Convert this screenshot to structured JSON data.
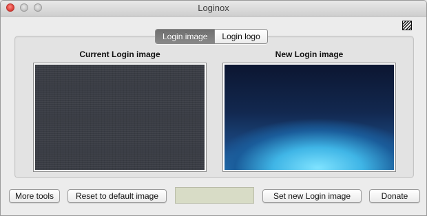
{
  "window": {
    "title": "Loginox"
  },
  "tabs": [
    {
      "label": "Login image",
      "active": true
    },
    {
      "label": "Login logo",
      "active": false
    }
  ],
  "panels": {
    "current_label": "Current Login image",
    "new_label": "New Login image"
  },
  "buttons": {
    "more_tools": "More tools",
    "reset": "Reset to default image",
    "set_new": "Set new Login image",
    "donate": "Donate"
  },
  "icons": {
    "close": "close-traffic-light",
    "minimize": "minimize-traffic-light",
    "zoom": "zoom-traffic-light",
    "corner": "app-logo-icon"
  },
  "colors": {
    "close_red": "#e0443e",
    "tab_active": "#7a7a7a",
    "status_field": "#d8dcc6"
  }
}
